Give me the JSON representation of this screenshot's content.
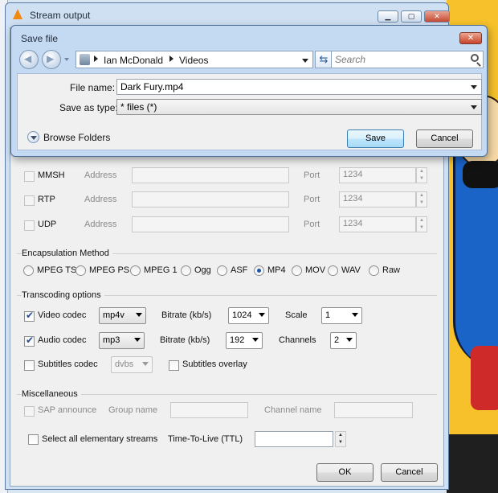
{
  "stream_window": {
    "title": "Stream output",
    "outputs": [
      {
        "name": "MMSH",
        "address_label": "Address",
        "port_label": "Port",
        "port": "1234"
      },
      {
        "name": "RTP",
        "address_label": "Address",
        "port_label": "Port",
        "port": "1234"
      },
      {
        "name": "UDP",
        "address_label": "Address",
        "port_label": "Port",
        "port": "1234"
      }
    ],
    "encapsulation": {
      "title": "Encapsulation Method",
      "options": [
        "MPEG TS",
        "MPEG PS",
        "MPEG 1",
        "Ogg",
        "ASF",
        "MP4",
        "MOV",
        "WAV",
        "Raw"
      ],
      "selected": "MP4"
    },
    "transcoding": {
      "title": "Transcoding options",
      "video_codec_label": "Video codec",
      "video_codec": "mp4v",
      "video_bitrate_label": "Bitrate (kb/s)",
      "video_bitrate": "1024",
      "scale_label": "Scale",
      "scale": "1",
      "audio_codec_label": "Audio codec",
      "audio_codec": "mp3",
      "audio_bitrate_label": "Bitrate (kb/s)",
      "audio_bitrate": "192",
      "channels_label": "Channels",
      "channels": "2",
      "subtitles_codec_label": "Subtitles codec",
      "subtitles_codec": "dvbs",
      "subtitles_overlay_label": "Subtitles overlay"
    },
    "misc": {
      "title": "Miscellaneous",
      "sap_label": "SAP announce",
      "group_label": "Group name",
      "channel_label": "Channel name",
      "select_all_label": "Select all elementary streams",
      "ttl_label": "Time-To-Live (TTL)"
    },
    "ok_label": "OK",
    "cancel_label": "Cancel"
  },
  "save_dialog": {
    "title": "Save file",
    "breadcrumb": [
      "Ian McDonald",
      "Videos"
    ],
    "search_placeholder": "Search",
    "file_name_label": "File name:",
    "file_name": "Dark Fury.mp4",
    "save_type_label": "Save as type:",
    "save_type": "* files (*)",
    "browse_folders_label": "Browse Folders",
    "save_label": "Save",
    "cancel_label": "Cancel"
  },
  "colors": {
    "accent": "#1c55a8",
    "titlebar": "#cfe0f2",
    "close_red": "#c8432a"
  }
}
